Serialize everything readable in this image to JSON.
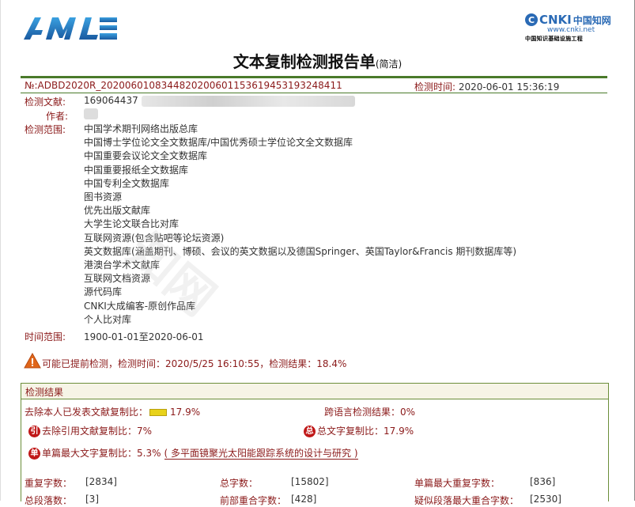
{
  "header": {
    "left_logo": "AMLC",
    "cnki_brand": "CNKI",
    "cnki_brand_cn": "中国知网",
    "cnki_url": "www.cnki.net",
    "cnki_subtitle": "中国知识基础设施工程"
  },
  "report": {
    "title": "文本复制检测报告单",
    "title_suffix": "(简洁)",
    "report_no": "№:ADBD2020R_2020060108344820200601153619453193248411",
    "check_time_label": "检测时间:",
    "check_time_value": "2020-06-01 15:36:19",
    "doc_label": "检测文献:",
    "doc_value": "169064437",
    "author_label": "作者:",
    "scope_label": "检测范围:",
    "scope_items": [
      "中国学术期刊网络出版总库",
      "中国博士学位论文全文数据库/中国优秀硕士学位论文全文数据库",
      "中国重要会议论文全文数据库",
      "中国重要报纸全文数据库",
      "中国专利全文数据库",
      "图书资源",
      "优先出版文献库",
      "大学生论文联合比对库",
      "互联网资源(包含贴吧等论坛资源)",
      "英文数据库(涵盖期刊、博硕、会议的英文数据以及德国Springer、英国Taylor&Francis 期刊数据库等)",
      "港澳台学术文献库",
      "互联网文档资源",
      "源代码库",
      "CNKI大成编客-原创作品库",
      "个人比对库"
    ],
    "time_range_label": "时间范围:",
    "time_range_value": "1900-01-01至2020-06-01",
    "warning": "可能已提前检测，检测时间：2020/5/25 16:10:55，检测结果：18.4%",
    "watermark": "知网"
  },
  "results": {
    "section_title": "检测结果",
    "excl_self_label": "去除本人已发表文献复制比：",
    "excl_self_value": "17.9%",
    "excl_self_ratio": 0.179,
    "cross_lang_label": "跨语言检测结果：",
    "cross_lang_value": "0%",
    "excl_ref_badge": "引",
    "excl_ref_label": "去除引用文献复制比：",
    "excl_ref_value": "7%",
    "total_badge": "总",
    "total_label": "总文字复制比：",
    "total_value": "17.9%",
    "single_badge": "单",
    "single_label": "单篇最大文字复制比：",
    "single_value": "5.3%",
    "single_title": "( 多平面镜聚光太阳能跟踪系统的设计与研究 )",
    "stats": [
      {
        "label": "重复字数：",
        "value": "[2834]"
      },
      {
        "label": "总字数：",
        "value": "[15802]"
      },
      {
        "label": "单篇最大重复字数：",
        "value": "[836]"
      }
    ],
    "stats_row2": [
      {
        "label": "总段落数：",
        "value": "[3]"
      },
      {
        "label": "前部重合字数：",
        "value": "[428]"
      },
      {
        "label": "疑似段落最大重合字数：",
        "value": "[2530]"
      }
    ]
  },
  "colors": {
    "accent_red": "#8b1a1a",
    "green_rule": "#4a7a2a",
    "badge_red": "#c01818",
    "bar_yellow": "#e8d21a"
  }
}
